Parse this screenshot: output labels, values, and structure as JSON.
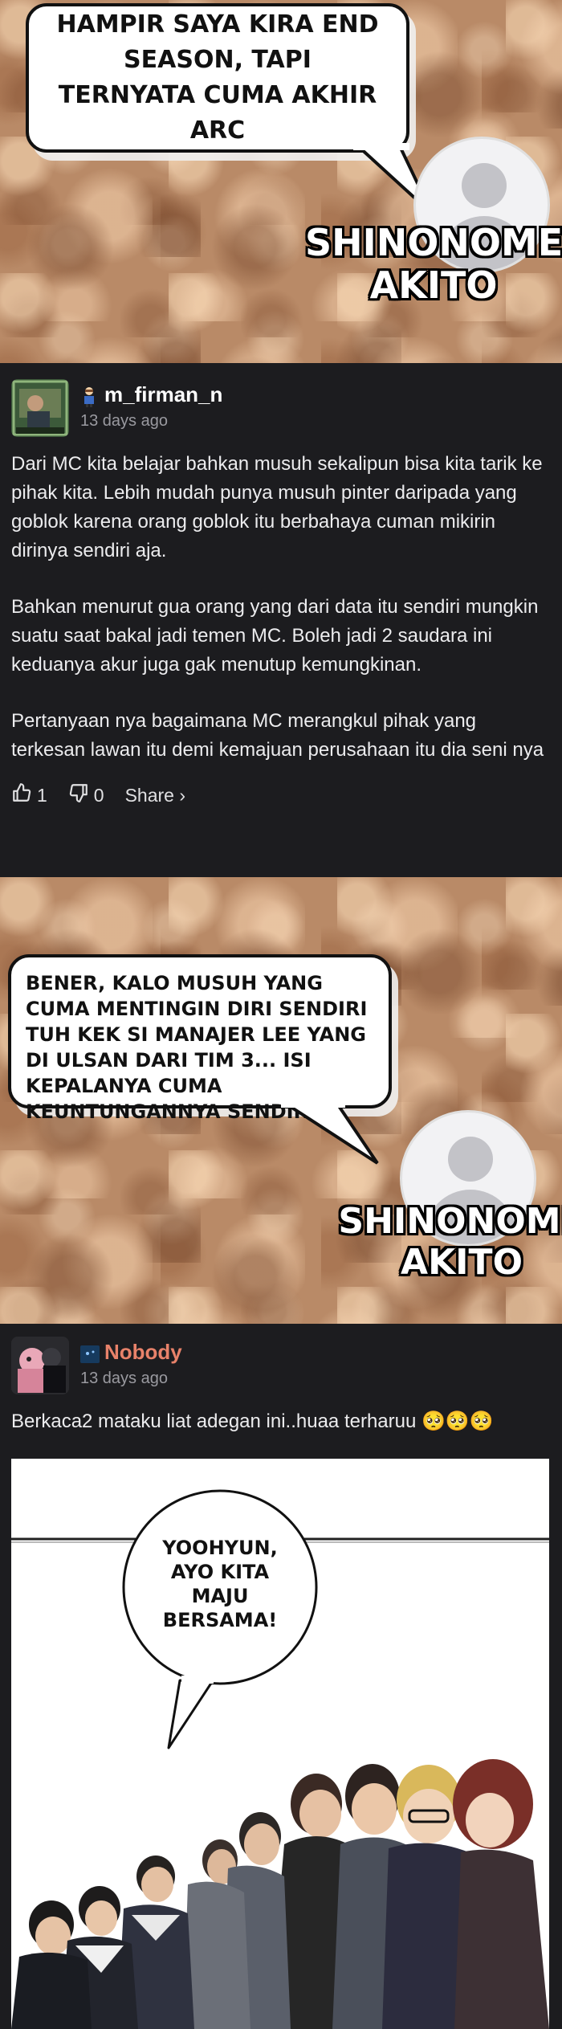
{
  "panel1": {
    "bubble_text": "Hampir saya kira end season, tapi ternyata cuma akhir arc",
    "name_line1": "Shinonome",
    "name_line2": "Akito"
  },
  "comment1": {
    "username": "m_firman_n",
    "time": "13 days ago",
    "paragraphs": [
      "Dari MC kita belajar bahkan musuh sekalipun bisa kita tarik ke pihak kita. Lebih mudah punya musuh pinter daripada yang goblok karena orang goblok itu berbahaya cuman mikirin dirinya sendiri aja.",
      "Bahkan menurut gua orang yang dari data itu sendiri mungkin suatu saat bakal jadi temen MC. Boleh jadi 2 saudara ini keduanya akur juga gak menutup kemungkinan.",
      "Pertanyaan nya bagaimana MC merangkul pihak yang terkesan lawan itu demi kemajuan perusahaan itu dia seni nya"
    ],
    "likes": "1",
    "dislikes": "0",
    "share_label": "Share ›",
    "username_color": "#ffffff"
  },
  "panel2": {
    "bubble_text": "Bener, kalo musuh yang cuma mentingin diri sendiri tuh kek si manajer Lee yang di ulsan dari tim 3... isi kepalanya cuma keuntungannya sendiri.",
    "name_line1": "Shinonome",
    "name_line2": "Akito"
  },
  "comment2": {
    "username": "Nobody",
    "time": "13 days ago",
    "text": "Berkaca2 mataku liat adegan ini..huaa terharuu 🥺🥺🥺",
    "username_color": "#e8826a"
  },
  "manga": {
    "bubble_text": "Yoohyun, ayo kita maju bersama!"
  }
}
